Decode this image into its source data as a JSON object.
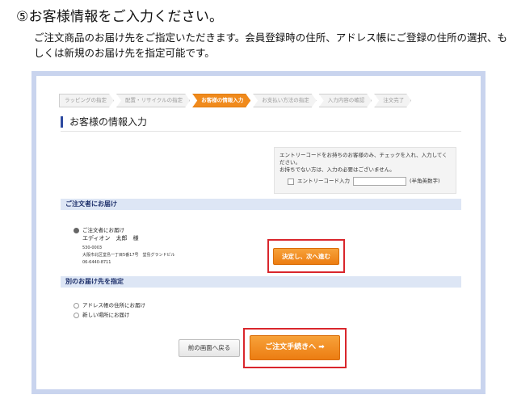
{
  "heading": {
    "step_title": "⑤お客様情報をご入力ください。",
    "intro": "ご注文商品のお届け先をご指定いただきます。会員登録時の住所、アドレス帳にご登録の住所の選択、もしくは新規のお届け先を指定可能です。"
  },
  "progress": {
    "steps": [
      {
        "label": "ラッピングの指定",
        "active": false
      },
      {
        "label": "配置・リサイクルの指定",
        "active": false
      },
      {
        "label": "お客様の情報入力",
        "active": true
      },
      {
        "label": "お支払い方法の指定",
        "active": false
      },
      {
        "label": "入力内容の確認",
        "active": false
      },
      {
        "label": "注文完了",
        "active": false
      }
    ]
  },
  "page": {
    "title": "お客様の情報入力"
  },
  "entry_code": {
    "line1": "エントリーコードをお持ちのお客様のみ、チェックを入れ、入力してください。",
    "line2": "お持ちでない方は、入力の必要はございません。",
    "checkbox_label": "エントリーコード入力",
    "input_value": "",
    "hint": "(半角英数字)"
  },
  "section_orderer": {
    "title": "ご注文者にお届け",
    "radio_label": "ご注文者にお届け",
    "name": "エディオン　太郎　様",
    "postal": "530-0003",
    "address": "大阪市北区堂島一丁目5番17号　堂島グランドビル",
    "phone": "06-6440-8711",
    "confirm_button": "決定し、次へ進む"
  },
  "section_other": {
    "title": "別のお届け先を指定",
    "options": [
      "アドレス帳の住所にお届け",
      "新しい場所にお届け"
    ]
  },
  "footer": {
    "back_button": "前の画面へ戻る",
    "proceed_button": "ご注文手続きへ ➡"
  },
  "colors": {
    "accent": "#f08a1c",
    "highlight": "#d9262c",
    "frame": "#c9d4ee",
    "section": "#dde6f5"
  }
}
